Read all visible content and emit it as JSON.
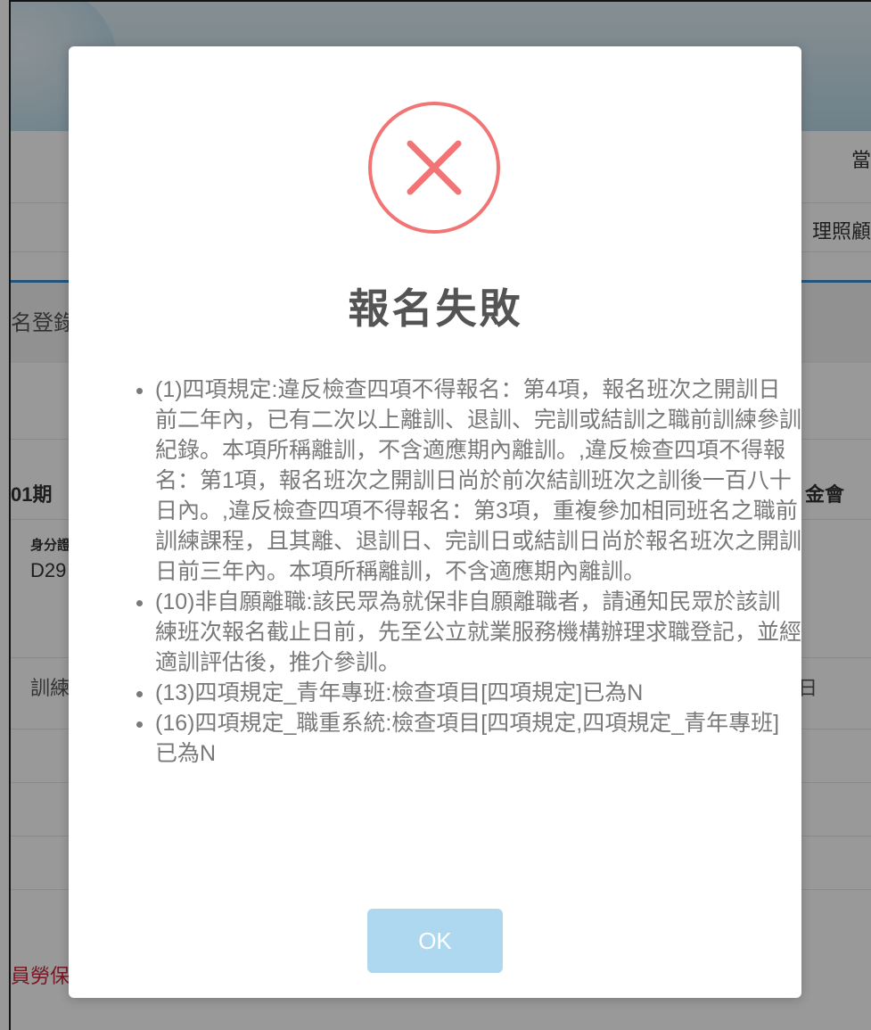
{
  "background": {
    "right_label_1": "當",
    "right_label_2": "理照顧",
    "left_heading": "名登錄",
    "session_label": "01期",
    "right_label_3": "金會",
    "id_label": "身分證",
    "id_value": "D29",
    "training_label": "訓練",
    "right_label_4": "日",
    "bottom_red_text": "員勞保"
  },
  "dialog": {
    "icon": "error-x-icon",
    "icon_color": "#f27474",
    "title": "報名失敗",
    "messages": [
      "(1)四項規定:違反檢查四項不得報名：第4項，報名班次之開訓日前二年內，已有二次以上離訓、退訓、完訓或結訓之職前訓練參訓紀錄。本項所稱離訓，不含適應期內離訓。,違反檢查四項不得報名：第1項，報名班次之開訓日尚於前次結訓班次之訓後一百八十日內。,違反檢查四項不得報名：第3項，重複參加相同班名之職前訓練課程，且其離、退訓日、完訓日或結訓日尚於報名班次之開訓日前三年內。本項所稱離訓，不含適應期內離訓。",
      "(10)非自願離職:該民眾為就保非自願離職者，請通知民眾於該訓練班次報名截止日前，先至公立就業服務機構辦理求職登記，並經適訓評估後，推介參訓。",
      "(13)四項規定_青年專班:檢查項目[四項規定]已為N",
      "(16)四項規定_職重系統:檢查項目[四項規定,四項規定_青年專班]已為N"
    ],
    "ok_label": "OK",
    "ok_color": "#add8f0"
  }
}
